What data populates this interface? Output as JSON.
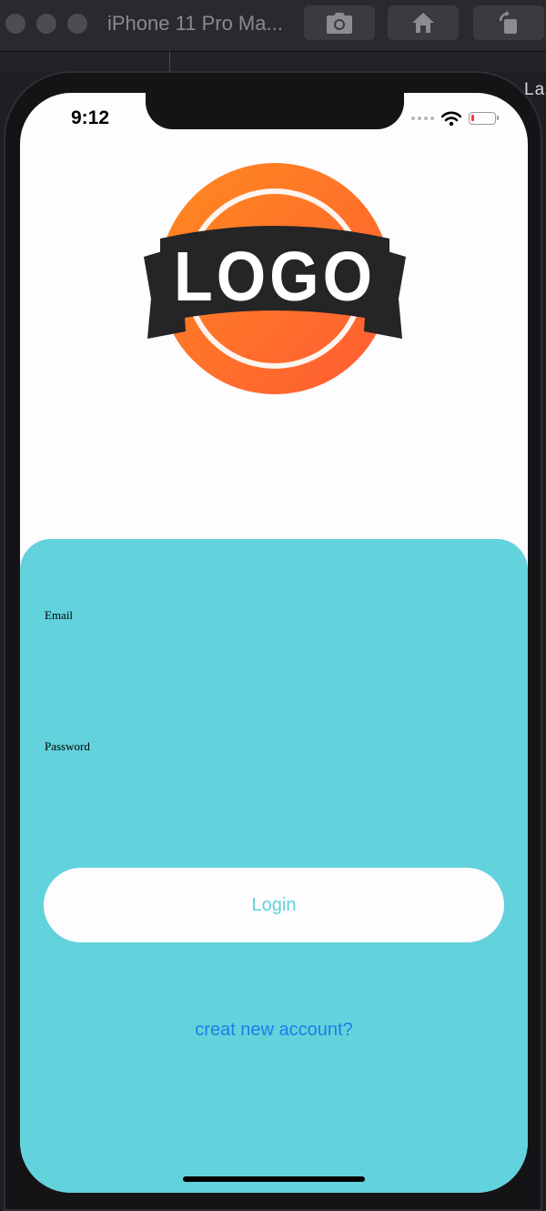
{
  "simulator": {
    "title": "iPhone 11 Pro Ma...",
    "edge_text": "Las",
    "toolbar_icons": [
      "camera-icon",
      "home-icon",
      "rotate-icon"
    ]
  },
  "status_bar": {
    "time": "9:12",
    "icons": [
      "signal-dots-icon",
      "wifi-icon",
      "battery-low-icon"
    ]
  },
  "logo": {
    "text": "LOGO"
  },
  "form": {
    "email_label": "Email",
    "email_value": "",
    "password_label": "Password",
    "password_value": "",
    "login_label": "Login",
    "create_account_label": "creat new account?"
  },
  "colors": {
    "panel": "#62d2dc",
    "login_text": "#62d2dc",
    "link": "#1f7ce6",
    "logo_orange": "#ff6a2a",
    "logo_ribbon": "#252427"
  }
}
